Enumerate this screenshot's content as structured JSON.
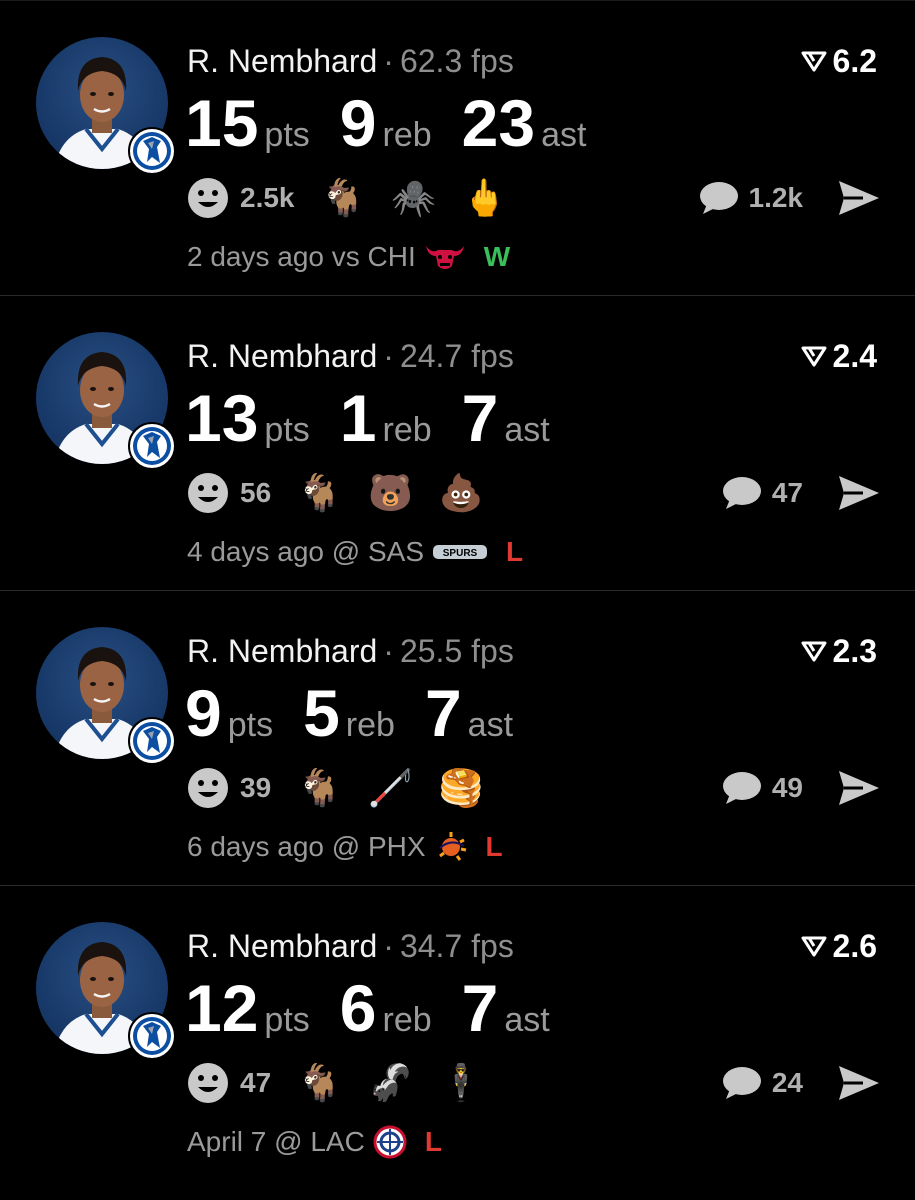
{
  "posts": [
    {
      "player": "R. Nembhard",
      "fps": "62.3 fps",
      "score": "6.2",
      "stats": [
        {
          "value": "15",
          "label": "pts"
        },
        {
          "value": "9",
          "label": "reb"
        },
        {
          "value": "23",
          "label": "ast"
        }
      ],
      "reaction_count": "2.5k",
      "emojis": [
        "🐐",
        "🕷️",
        "🖕"
      ],
      "comment_count": "1.2k",
      "game": "2 days ago vs CHI",
      "opponent_logo": "bulls-logo",
      "result": "W"
    },
    {
      "player": "R. Nembhard",
      "fps": "24.7 fps",
      "score": "2.4",
      "stats": [
        {
          "value": "13",
          "label": "pts"
        },
        {
          "value": "1",
          "label": "reb"
        },
        {
          "value": "7",
          "label": "ast"
        }
      ],
      "reaction_count": "56",
      "emojis": [
        "🐐",
        "🐻",
        "💩"
      ],
      "comment_count": "47",
      "game": "4 days ago @ SAS",
      "opponent_logo": "spurs-logo",
      "result": "L"
    },
    {
      "player": "R. Nembhard",
      "fps": "25.5 fps",
      "score": "2.3",
      "stats": [
        {
          "value": "9",
          "label": "pts"
        },
        {
          "value": "5",
          "label": "reb"
        },
        {
          "value": "7",
          "label": "ast"
        }
      ],
      "reaction_count": "39",
      "emojis": [
        "🐐",
        "🦯",
        "🥞"
      ],
      "comment_count": "49",
      "game": "6 days ago @ PHX",
      "opponent_logo": "suns-logo",
      "result": "L"
    },
    {
      "player": "R. Nembhard",
      "fps": "34.7 fps",
      "score": "2.6",
      "stats": [
        {
          "value": "12",
          "label": "pts"
        },
        {
          "value": "6",
          "label": "reb"
        },
        {
          "value": "7",
          "label": "ast"
        }
      ],
      "reaction_count": "47",
      "emojis": [
        "🐐",
        "🦨",
        "🕴️"
      ],
      "comment_count": "24",
      "game": "April 7 @ LAC",
      "opponent_logo": "clippers-logo",
      "result": "L"
    }
  ],
  "icons": {
    "reaction": "smiley-icon",
    "comment": "comment-bubble-icon",
    "share": "share-arrow-icon",
    "score": "score-chevron-icon",
    "team": "mavericks-logo"
  },
  "colors": {
    "win": "#3bbf5a",
    "loss": "#e0392f",
    "background": "#000000",
    "muted": "#9a9a9a"
  }
}
